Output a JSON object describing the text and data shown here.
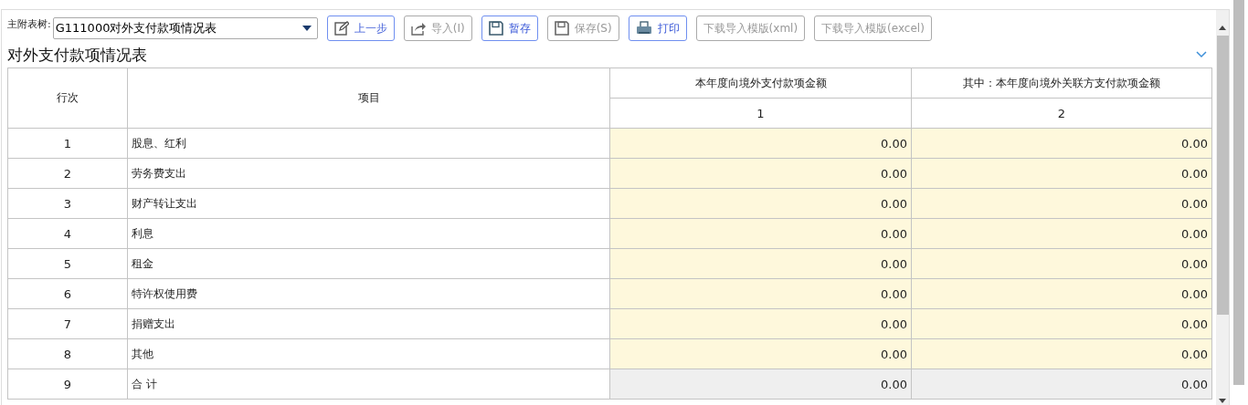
{
  "selector": {
    "label": "主附表树:",
    "value": "G111000对外支付款项情况表"
  },
  "buttons": [
    {
      "label": "上一步",
      "kind": "edit",
      "disabled": false
    },
    {
      "label": "导入(I)",
      "kind": "import",
      "disabled": true
    },
    {
      "label": "暂存",
      "kind": "save",
      "disabled": false
    },
    {
      "label": "保存(S)",
      "kind": "save",
      "disabled": true
    },
    {
      "label": "打印",
      "kind": "print",
      "disabled": false
    },
    {
      "label": "下载导入模版(xml)",
      "kind": "text",
      "disabled": true
    },
    {
      "label": "下载导入模版(excel)",
      "kind": "text",
      "disabled": true
    }
  ],
  "title": "对外支付款项情况表",
  "table": {
    "columns": [
      "行次",
      "项目",
      "本年度向境外支付款项金额",
      "其中：本年度向境外关联方支付款项金额"
    ],
    "column_numbers": [
      "1",
      "2"
    ],
    "rows": [
      {
        "kind": "input",
        "no": "1",
        "item": "股息、红利",
        "values": [
          "0.00",
          "0.00"
        ]
      },
      {
        "kind": "input",
        "no": "2",
        "item": "劳务费支出",
        "values": [
          "0.00",
          "0.00"
        ]
      },
      {
        "kind": "input",
        "no": "3",
        "item": "财产转让支出",
        "values": [
          "0.00",
          "0.00"
        ]
      },
      {
        "kind": "input",
        "no": "4",
        "item": "利息",
        "values": [
          "0.00",
          "0.00"
        ]
      },
      {
        "kind": "input",
        "no": "5",
        "item": "租金",
        "values": [
          "0.00",
          "0.00"
        ]
      },
      {
        "kind": "input",
        "no": "6",
        "item": "特许权使用费",
        "values": [
          "0.00",
          "0.00"
        ]
      },
      {
        "kind": "input",
        "no": "7",
        "item": "捐赠支出",
        "values": [
          "0.00",
          "0.00"
        ]
      },
      {
        "kind": "input",
        "no": "8",
        "item": "其他",
        "values": [
          "0.00",
          "0.00"
        ]
      },
      {
        "kind": "total",
        "no": "9",
        "item": "合 计",
        "values": [
          "0.00",
          "0.00"
        ]
      }
    ]
  }
}
